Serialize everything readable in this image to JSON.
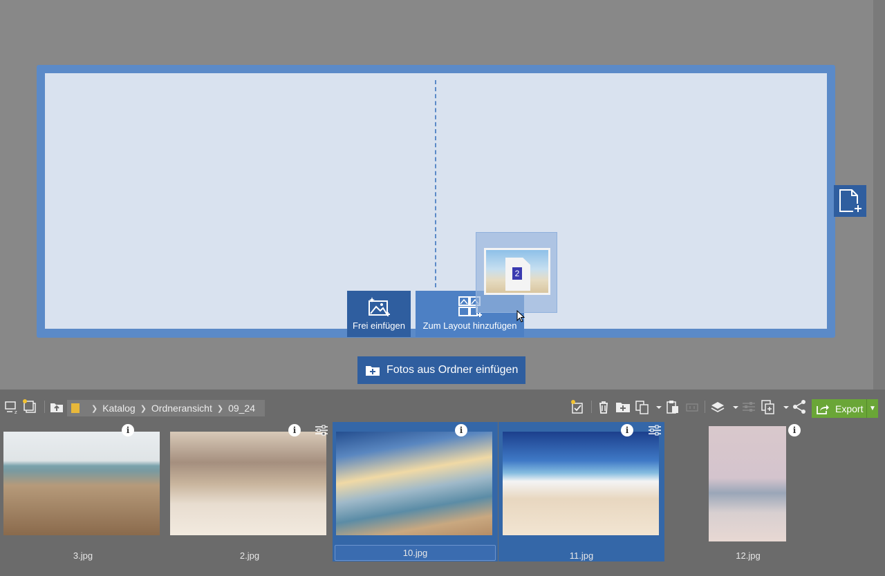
{
  "canvas": {
    "drop_free_label": "Frei einfügen",
    "drop_layout_label": "Zum Layout hinzufügen",
    "drag_count": "2",
    "folder_button_label": "Fotos aus Ordner einfügen"
  },
  "breadcrumb": {
    "items": [
      "Katalog",
      "Ordneransicht",
      "09_24"
    ]
  },
  "toolbar": {
    "export_label": "Export"
  },
  "thumbnails": [
    {
      "name": "3.jpg",
      "selected": false
    },
    {
      "name": "2.jpg",
      "selected": false
    },
    {
      "name": "10.jpg",
      "selected": true
    },
    {
      "name": "11.jpg",
      "selected": true
    },
    {
      "name": "12.jpg",
      "selected": false
    }
  ],
  "colors": {
    "background": "#888888",
    "accent": "#2f5e9f",
    "page_frame": "#5b8ac8",
    "export": "#6aa637"
  }
}
